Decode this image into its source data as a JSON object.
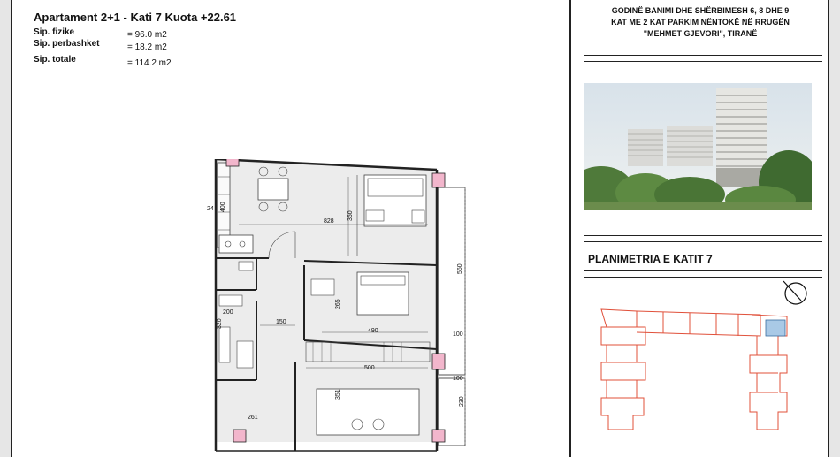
{
  "header": {
    "title": "Apartament 2+1 -   Kati 7   Kuota  +22.61",
    "rows": [
      {
        "label": "Sip. fizike",
        "value": "=   96.0 m2"
      },
      {
        "label": "Sip. perbashket",
        "value": "=   18.2 m2"
      },
      {
        "label": "Sip. totale",
        "value": "=   114.2 m2"
      }
    ]
  },
  "project": {
    "line1": "GODINË BANIMI DHE SHËRBIMESH 6, 8 DHE 9",
    "line2": "KAT ME 2 KAT PARKIM NËNTOKË NË RRUGËN",
    "line3": "\"MEHMET GJEVORI\", TIRANË"
  },
  "plan_title": "PLANIMETRIA E KATIT 7",
  "dimensions": {
    "d400": "400",
    "d828": "828",
    "d350": "350",
    "d560": "560",
    "d265": "265",
    "d200": "200",
    "d150": "150",
    "d490": "490",
    "d100a": "100",
    "d500": "500",
    "d100b": "100",
    "d351": "351",
    "d230": "230",
    "d261": "261",
    "d320": "320",
    "d24a": "24",
    "d24b": "24"
  },
  "colors": {
    "plan_line": "#222222",
    "plan_fill": "#e9e9e9",
    "column_fill": "#f2b6cc",
    "key_plan_line": "#e0503a",
    "key_plan_highlight": "#a9c9e6",
    "frame": "#e6e6e6"
  },
  "icons": {
    "north_arrow": "north-arrow-icon"
  }
}
